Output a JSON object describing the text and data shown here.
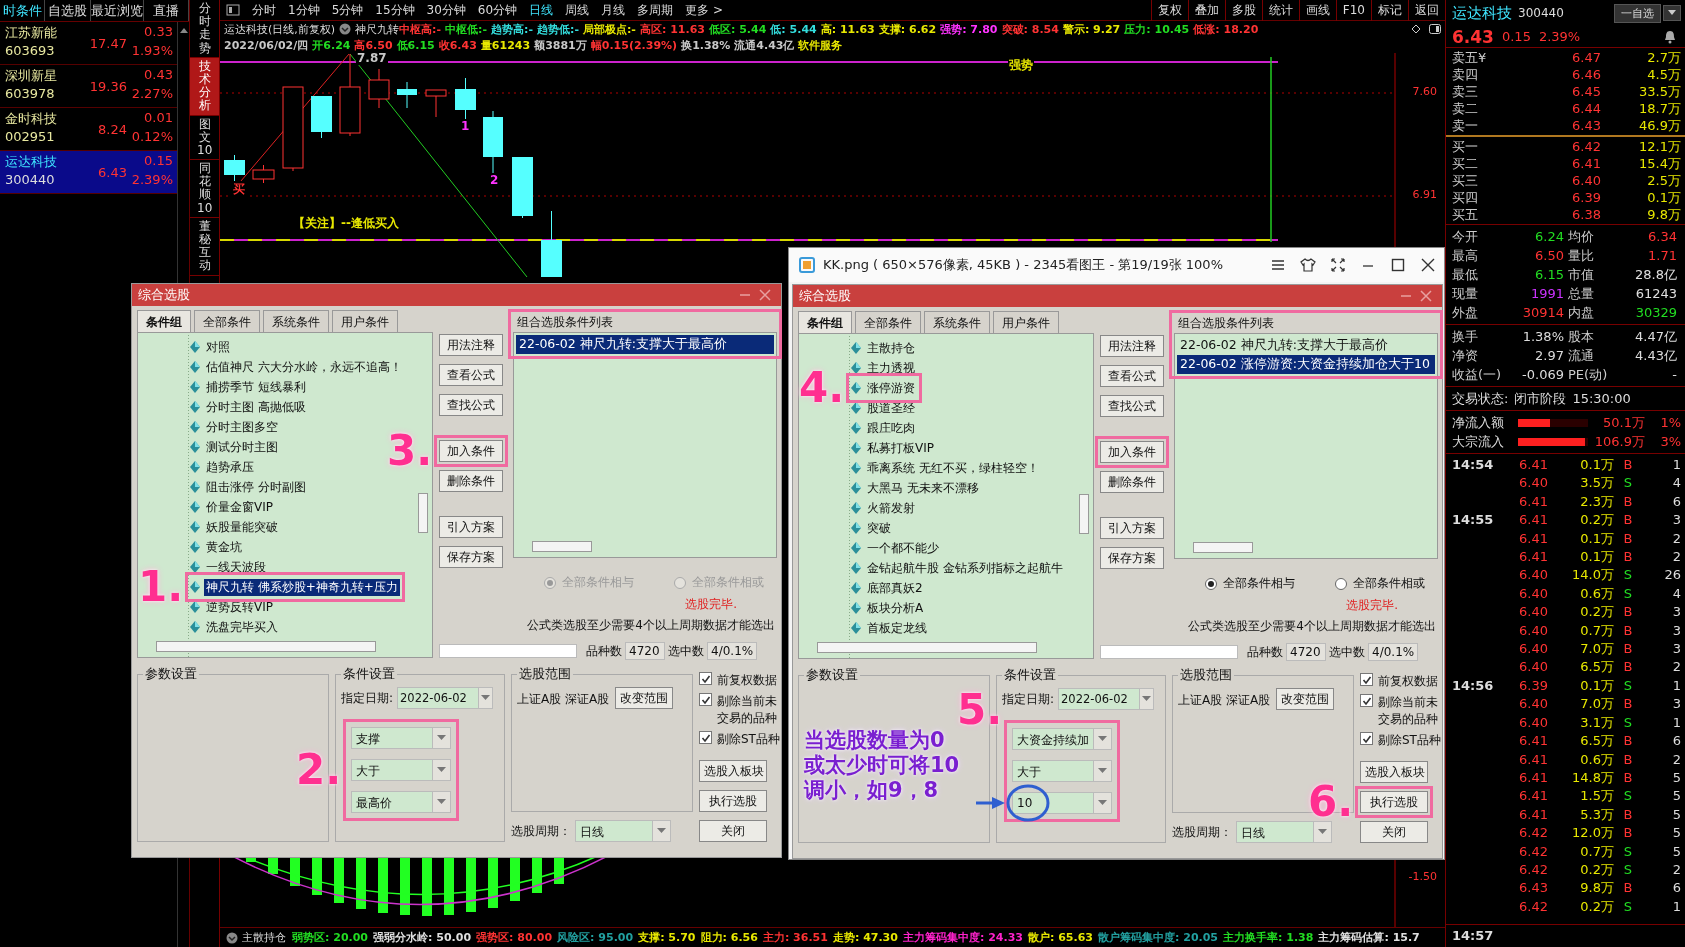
{
  "left_panel": {
    "tabs": [
      {
        "label": "时条件",
        "selected": true
      },
      {
        "label": "自选股",
        "selected": false
      },
      {
        "label": "最近浏览",
        "selected": false
      },
      {
        "label": "直播",
        "selected": false
      }
    ],
    "stocks": [
      {
        "name": "江苏新能",
        "code": "603693",
        "price": "17.47",
        "change": "0.33",
        "pct": "1.93%",
        "selected": false
      },
      {
        "name": "深圳新星",
        "code": "603978",
        "price": "19.36",
        "change": "0.43",
        "pct": "2.27%",
        "selected": false
      },
      {
        "name": "金时科技",
        "code": "002951",
        "price": "8.24",
        "change": "0.01",
        "pct": "0.12%",
        "selected": false
      },
      {
        "name": "运达科技",
        "code": "300440",
        "price": "6.43",
        "change": "0.15",
        "pct": "2.39%",
        "selected": true
      }
    ]
  },
  "side_tabs": [
    {
      "label": "分时走势",
      "selected": false
    },
    {
      "label": "技术分析",
      "selected": true
    },
    {
      "label": "图文10",
      "selected": false
    },
    {
      "label": "同花顺10",
      "selected": false
    },
    {
      "label": "董秘互动",
      "selected": false
    }
  ],
  "chart": {
    "periods": [
      {
        "label": "分时",
        "selected": false
      },
      {
        "label": "1分钟",
        "selected": false
      },
      {
        "label": "5分钟",
        "selected": false
      },
      {
        "label": "15分钟",
        "selected": false
      },
      {
        "label": "30分钟",
        "selected": false
      },
      {
        "label": "60分钟",
        "selected": false
      },
      {
        "label": "日线",
        "selected": true
      },
      {
        "label": "周线",
        "selected": false
      },
      {
        "label": "月线",
        "selected": false
      },
      {
        "label": "多周期",
        "selected": false
      },
      {
        "label": "更多 >",
        "selected": false
      }
    ],
    "tools": [
      "复权",
      "叠加",
      "多股",
      "统计",
      "画线",
      "F10",
      "标记",
      "返回"
    ],
    "title": "运达科技(日线,前复权)",
    "indicator": "神尺九转",
    "indicator_values": [
      {
        "text": "中枢高:-",
        "color": "#ff3333"
      },
      {
        "text": "中枢低:-",
        "color": "#22dd22"
      },
      {
        "text": "趋势高:-",
        "color": "#33dddd"
      },
      {
        "text": "趋势低:-",
        "color": "#33dddd"
      },
      {
        "text": "局部极点:-",
        "color": "#e8e800"
      },
      {
        "text": "高区: 11.63",
        "color": "#ff3333"
      },
      {
        "text": "低区: 5.44",
        "color": "#22dd22"
      },
      {
        "text": "低: 5.44",
        "color": "#33dddd"
      },
      {
        "text": "高: 11.63",
        "color": "#e8e800"
      },
      {
        "text": "支撑: 6.62",
        "color": "#e8e800"
      },
      {
        "text": "强势: 7.80",
        "color": "#ff33ff"
      },
      {
        "text": "突破: 8.54",
        "color": "#ff3333"
      },
      {
        "text": "警示: 9.27",
        "color": "#e8e800"
      },
      {
        "text": "压力: 10.45",
        "color": "#22dd22"
      },
      {
        "text": "低涨: 18.20",
        "color": "#ff3333"
      }
    ],
    "quote_line": [
      {
        "text": "2022/06/02/四",
        "color": "#c8c8c8"
      },
      {
        "text": "开6.24",
        "color": "#22dd22"
      },
      {
        "text": "高6.50",
        "color": "#ff3333"
      },
      {
        "text": "低6.15",
        "color": "#22dd22"
      },
      {
        "text": "收6.43",
        "color": "#ff3333"
      },
      {
        "text": "量61243",
        "color": "#e8e800"
      },
      {
        "text": "额3881万",
        "color": "#c8c8c8"
      },
      {
        "text": "幅0.15(2.39%)",
        "color": "#ff3333"
      },
      {
        "text": "换1.38%",
        "color": "#c8c8c8"
      },
      {
        "text": "流通4.43亿",
        "color": "#c8c8c8"
      },
      {
        "text": "软件服务",
        "color": "#e8e800"
      }
    ],
    "labels": [
      {
        "text": "7.87",
        "color": "#c8c8c8"
      },
      {
        "text": "强势",
        "color": "#e8e800"
      },
      {
        "text": "1",
        "color": "#ff33ff"
      },
      {
        "text": "2",
        "color": "#ff33ff"
      },
      {
        "text": "买",
        "color": "#ff3333"
      },
      {
        "text": "【关注】--逢低买入",
        "color": "#e8e800"
      }
    ],
    "price_ticks": [
      "7.60",
      "6.91",
      "-1.50"
    ],
    "bottom_indicator": {
      "name": "主散持仓",
      "values": [
        {
          "text": "弱势区: 20.00",
          "color": "#22dd22"
        },
        {
          "text": "强弱分水岭: 50.00",
          "color": "#e0e0e0"
        },
        {
          "text": "强势区: 80.00",
          "color": "#ff3333"
        },
        {
          "text": "风险区: 95.00",
          "color": "#22a0a0"
        },
        {
          "text": "支撑: 5.70",
          "color": "#e8e800"
        },
        {
          "text": "阻力: 6.56",
          "color": "#e8e800"
        },
        {
          "text": "主力: 36.51",
          "color": "#ff3333"
        },
        {
          "text": "走势: 47.30",
          "color": "#e8e800"
        },
        {
          "text": "主力筹码集中度: 24.33",
          "color": "#ff22cc"
        },
        {
          "text": "散户: 65.63",
          "color": "#e8e800"
        },
        {
          "text": "散户筹码集中度: 20.05",
          "color": "#22a0a0"
        },
        {
          "text": "主力换手率: 1.38",
          "color": "#22dd22"
        },
        {
          "text": "主力筹码估算: 15.7",
          "color": "#e0e0e0"
        }
      ]
    }
  },
  "quote_panel": {
    "name": "运达科技",
    "code": "300440",
    "watch_button": "一自选",
    "price": "6.43",
    "change": "0.15",
    "pct": "2.39%",
    "sells": [
      {
        "label": "卖五¥",
        "price": "6.47",
        "volume": "2.7万"
      },
      {
        "label": "卖四",
        "price": "6.46",
        "volume": "4.5万"
      },
      {
        "label": "卖三",
        "price": "6.45",
        "volume": "33.5万"
      },
      {
        "label": "卖二",
        "price": "6.44",
        "volume": "18.7万"
      },
      {
        "label": "卖一",
        "price": "6.43",
        "volume": "46.9万"
      }
    ],
    "buys": [
      {
        "label": "买一",
        "price": "6.42",
        "volume": "12.1万"
      },
      {
        "label": "买二",
        "price": "6.41",
        "volume": "15.4万"
      },
      {
        "label": "买三",
        "price": "6.40",
        "volume": "2.5万"
      },
      {
        "label": "买四",
        "price": "6.39",
        "volume": "0.1万"
      },
      {
        "label": "买五",
        "price": "6.38",
        "volume": "9.8万"
      }
    ],
    "stats": [
      {
        "label": "今开",
        "value": "6.24",
        "color": "#22dd22"
      },
      {
        "label": "均价",
        "value": "6.34",
        "color": "#ff3333"
      },
      {
        "label": "最高",
        "value": "6.50",
        "color": "#ff3333"
      },
      {
        "label": "量比",
        "value": "1.71",
        "color": "#ff3333"
      },
      {
        "label": "最低",
        "value": "6.15",
        "color": "#22dd22"
      },
      {
        "label": "市值",
        "value": "28.8亿",
        "color": "#e0e0e0"
      },
      {
        "label": "现量",
        "value": "1991",
        "color": "#cc33ff"
      },
      {
        "label": "总量",
        "value": "61243",
        "color": "#e0e0e0"
      },
      {
        "label": "外盘",
        "value": "30914",
        "color": "#ff3333"
      },
      {
        "label": "内盘",
        "value": "30329",
        "color": "#22dd22"
      }
    ],
    "fundamentals": [
      {
        "label": "换手",
        "value": "1.38%"
      },
      {
        "label": "股本",
        "value": "4.47亿"
      },
      {
        "label": "净资",
        "value": "2.97"
      },
      {
        "label": "流通",
        "value": "4.43亿"
      },
      {
        "label": "收益(一)",
        "value": "-0.069"
      },
      {
        "label": "PE(动)",
        "value": "-"
      }
    ],
    "status": {
      "label": "交易状态:",
      "value": "闭市阶段",
      "time": "15:30:00"
    },
    "flows": [
      {
        "label": "净流入额",
        "level": 0.45,
        "amount": "50.1万",
        "pct": "1%"
      },
      {
        "label": "大宗流入",
        "level": 0.95,
        "amount": "106.9万",
        "pct": "3%"
      }
    ],
    "trades": [
      {
        "time": "14:54",
        "rows": [
          {
            "price": "6.41",
            "volume": "0.1万",
            "side": "B",
            "kind": "buy",
            "count": "1"
          },
          {
            "price": "6.40",
            "volume": "3.5万",
            "side": "S",
            "kind": "sell",
            "count": "4"
          },
          {
            "price": "6.41",
            "volume": "2.3万",
            "side": "B",
            "kind": "buy",
            "count": "6"
          }
        ]
      },
      {
        "time": "14:55",
        "rows": [
          {
            "price": "6.41",
            "volume": "0.2万",
            "side": "B",
            "kind": "buy",
            "count": "3"
          },
          {
            "price": "6.41",
            "volume": "0.1万",
            "side": "B",
            "kind": "buy",
            "count": "2"
          },
          {
            "price": "6.41",
            "volume": "0.1万",
            "side": "B",
            "kind": "buy",
            "count": "2"
          },
          {
            "price": "6.40",
            "volume": "14.0万",
            "side": "S",
            "kind": "sell",
            "count": "26"
          },
          {
            "price": "6.40",
            "volume": "0.6万",
            "side": "S",
            "kind": "sell",
            "count": "4"
          },
          {
            "price": "6.40",
            "volume": "0.2万",
            "side": "B",
            "kind": "buy",
            "count": "3"
          },
          {
            "price": "6.40",
            "volume": "0.7万",
            "side": "B",
            "kind": "buy",
            "count": "3"
          },
          {
            "price": "6.40",
            "volume": "7.0万",
            "side": "B",
            "kind": "buy",
            "count": "3"
          },
          {
            "price": "6.40",
            "volume": "6.5万",
            "side": "B",
            "kind": "buy",
            "count": "2"
          }
        ]
      },
      {
        "time": "14:56",
        "rows": [
          {
            "price": "6.39",
            "volume": "0.1万",
            "side": "S",
            "kind": "sell",
            "count": "1"
          },
          {
            "price": "6.40",
            "volume": "7.0万",
            "side": "B",
            "kind": "buy",
            "count": "3"
          },
          {
            "price": "6.40",
            "volume": "3.1万",
            "side": "S",
            "kind": "sell",
            "count": "1"
          },
          {
            "price": "6.41",
            "volume": "6.5万",
            "side": "B",
            "kind": "buy",
            "count": "6"
          },
          {
            "price": "6.41",
            "volume": "0.6万",
            "side": "B",
            "kind": "buy",
            "count": "2"
          },
          {
            "price": "6.41",
            "volume": "14.8万",
            "side": "B",
            "kind": "buy",
            "count": "5"
          },
          {
            "price": "6.41",
            "volume": "1.5万",
            "side": "S",
            "kind": "sell",
            "count": "5"
          },
          {
            "price": "6.41",
            "volume": "5.3万",
            "side": "B",
            "kind": "buy",
            "count": "5"
          },
          {
            "price": "6.42",
            "volume": "12.0万",
            "side": "B",
            "kind": "buy",
            "count": "5"
          },
          {
            "price": "6.42",
            "volume": "0.7万",
            "side": "S",
            "kind": "sell",
            "count": "5"
          },
          {
            "price": "6.42",
            "volume": "0.2万",
            "side": "S",
            "kind": "sell",
            "count": "2"
          },
          {
            "price": "6.43",
            "volume": "9.8万",
            "side": "B",
            "kind": "buy",
            "count": "6"
          },
          {
            "price": "6.42",
            "volume": "0.2万",
            "side": "S",
            "kind": "sell",
            "count": "1"
          }
        ]
      }
    ],
    "last_time": "14:57"
  },
  "viewer": {
    "title": "KK.png ( 650×576像素, 45KB ) - 2345看图王 - 第19/19张 100%"
  },
  "dialogs": [
    {
      "title": "综合选股",
      "tabs": [
        {
          "label": "条件组",
          "selected": true
        },
        {
          "label": "全部条件",
          "selected": false
        },
        {
          "label": "系统条件",
          "selected": false
        },
        {
          "label": "用户条件",
          "selected": false
        }
      ],
      "tree": [
        {
          "label": "对照",
          "selected": false,
          "frame": false
        },
        {
          "label": "估值神尺 六大分水岭，永远不追高！",
          "selected": false,
          "frame": false
        },
        {
          "label": "捕捞季节 短线暴利",
          "selected": false,
          "frame": false
        },
        {
          "label": "分时主图 高抛低吸",
          "selected": false,
          "frame": false
        },
        {
          "label": "分时主图多空",
          "selected": false,
          "frame": false
        },
        {
          "label": "测试分时主图",
          "selected": false,
          "frame": false
        },
        {
          "label": "趋势承压",
          "selected": false,
          "frame": false
        },
        {
          "label": "阻击涨停 分时副图",
          "selected": false,
          "frame": false
        },
        {
          "label": "价量金窗VIP",
          "selected": false,
          "frame": false
        },
        {
          "label": "妖股量能突破",
          "selected": false,
          "frame": false
        },
        {
          "label": "黄金坑",
          "selected": false,
          "frame": false
        },
        {
          "label": "一线天波段",
          "selected": false,
          "frame": false
        },
        {
          "label": "神尺九转 佛系炒股+神奇九转+压力",
          "selected": true,
          "frame": true,
          "step": "1."
        },
        {
          "label": "逆势反转VIP",
          "selected": false,
          "frame": false
        },
        {
          "label": "洗盘完毕买入",
          "selected": false,
          "frame": false
        }
      ],
      "buttons": [
        {
          "label": "用法注释",
          "frame": false
        },
        {
          "label": "查看公式",
          "frame": false
        },
        {
          "label": "查找公式",
          "frame": false
        },
        {
          "label": "加入条件",
          "frame": true,
          "step": "3."
        },
        {
          "label": "删除条件",
          "frame": false
        },
        {
          "label": "引入方案",
          "frame": false
        },
        {
          "label": "保存方案",
          "frame": false
        }
      ],
      "list": {
        "label": "组合选股条件列表",
        "frame": true,
        "items": [
          {
            "text": "22-06-02 神尺九转:支撑大于最高价",
            "selected": true
          }
        ]
      },
      "radios": [
        {
          "label": "全部条件相与",
          "selected": true,
          "disabled": true
        },
        {
          "label": "全部条件相或",
          "selected": false,
          "disabled": true
        }
      ],
      "status": "选股完毕.",
      "note": "公式类选股至少需要4个以上周期数据才能选出",
      "progress": {
        "level": 0
      },
      "counts": [
        {
          "label": "品种数",
          "value": "4720"
        },
        {
          "label": "选中数",
          "value": "4/0.1%"
        }
      ],
      "params_title": "参数设置",
      "cond_title": "条件设置",
      "date_label": "指定日期:",
      "date": "2022-06-02",
      "conditions": {
        "fields": [
          "支撑",
          "大于",
          "最高价"
        ],
        "frame": true,
        "step": "2."
      },
      "range_title": "选股范围",
      "range": "上证A股 深证A股",
      "range_button": "改变范围",
      "period_label": "选股周期：",
      "period": "日线",
      "checks": [
        {
          "label": "前复权数据",
          "checked": true
        },
        {
          "label": "剔除当前未交易的品种",
          "checked": true
        },
        {
          "label": "剔除ST品种",
          "checked": true
        }
      ],
      "actions": [
        {
          "label": "选股入板块",
          "frame": false
        },
        {
          "label": "执行选股",
          "frame": false
        },
        {
          "label": "关闭",
          "frame": false
        }
      ]
    },
    {
      "title": "综合选股",
      "tabs": [
        {
          "label": "条件组",
          "selected": true
        },
        {
          "label": "全部条件",
          "selected": false
        },
        {
          "label": "系统条件",
          "selected": false
        },
        {
          "label": "用户条件",
          "selected": false
        }
      ],
      "tree": [
        {
          "label": "主散持仓",
          "selected": false,
          "frame": false
        },
        {
          "label": "主力透视",
          "selected": false,
          "frame": false
        },
        {
          "label": "涨停游资",
          "selected": false,
          "frame": true,
          "step": "4."
        },
        {
          "label": "股道圣经",
          "selected": false,
          "frame": false
        },
        {
          "label": "跟庄吃肉",
          "selected": false,
          "frame": false
        },
        {
          "label": "私募打板VIP",
          "selected": false,
          "frame": false
        },
        {
          "label": "乖离系统 无红不买，绿柱轻空！",
          "selected": false,
          "frame": false
        },
        {
          "label": "大黑马 无未来不漂移",
          "selected": false,
          "frame": false
        },
        {
          "label": "火箭发射",
          "selected": false,
          "frame": false
        },
        {
          "label": "突破",
          "selected": false,
          "frame": false
        },
        {
          "label": "一个都不能少",
          "selected": false,
          "frame": false
        },
        {
          "label": "金钻起航牛股 金钻系列指标之起航牛",
          "selected": false,
          "frame": false
        },
        {
          "label": "底部真妖2",
          "selected": false,
          "frame": false
        },
        {
          "label": "板块分析A",
          "selected": false,
          "frame": false
        },
        {
          "label": "首板定龙线",
          "selected": false,
          "frame": false
        }
      ],
      "buttons": [
        {
          "label": "用法注释",
          "frame": false
        },
        {
          "label": "查看公式",
          "frame": false
        },
        {
          "label": "查找公式",
          "frame": false
        },
        {
          "label": "加入条件",
          "frame": true
        },
        {
          "label": "删除条件",
          "frame": false
        },
        {
          "label": "引入方案",
          "frame": false
        },
        {
          "label": "保存方案",
          "frame": false
        }
      ],
      "list": {
        "label": "组合选股条件列表",
        "frame": true,
        "items": [
          {
            "text": "22-06-02 神尺九转:支撑大于最高价",
            "selected": false
          },
          {
            "text": "22-06-02 涨停游资:大资金持续加仓大于10",
            "selected": true
          }
        ]
      },
      "radios": [
        {
          "label": "全部条件相与",
          "selected": true,
          "disabled": false
        },
        {
          "label": "全部条件相或",
          "selected": false,
          "disabled": false
        }
      ],
      "status": "选股完毕.",
      "note": "公式类选股至少需要4个以上周期数据才能选出",
      "progress": {
        "level": 0
      },
      "counts": [
        {
          "label": "品种数",
          "value": "4720"
        },
        {
          "label": "选中数",
          "value": "4/0.1%"
        }
      ],
      "params_title": "参数设置",
      "cond_title": "条件设置",
      "date_label": "指定日期:",
      "date": "2022-06-02",
      "conditions": {
        "fields": [
          "大资金持续加",
          "大于",
          "10"
        ],
        "frame": true,
        "step": "5."
      },
      "range_title": "选股范围",
      "range": "上证A股 深证A股",
      "range_button": "改变范围",
      "period_label": "选股周期：",
      "period": "日线",
      "checks": [
        {
          "label": "前复权数据",
          "checked": true
        },
        {
          "label": "剔除当前未交易的品种",
          "checked": true
        },
        {
          "label": "剔除ST品种",
          "checked": true
        }
      ],
      "actions": [
        {
          "label": "选股入板块",
          "frame": false
        },
        {
          "label": "执行选股",
          "frame": true,
          "step": "6."
        },
        {
          "label": "关闭",
          "frame": false
        }
      ]
    }
  ],
  "tip": {
    "lines": [
      "当选股数量为0",
      "或太少时可将10",
      "调小，如9，8"
    ]
  }
}
